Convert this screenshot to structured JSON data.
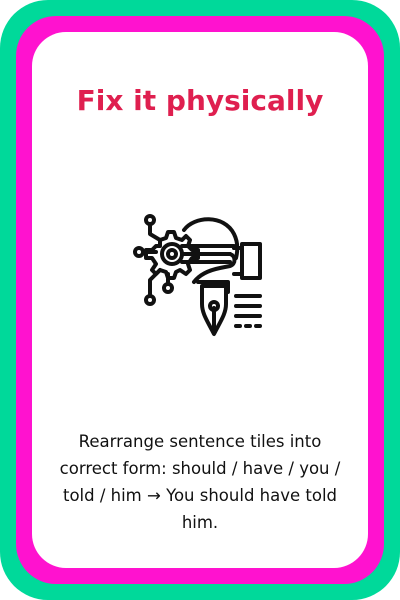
{
  "card": {
    "title": "Fix it physically",
    "illustration_icon": "hand-gear-pen-icon",
    "description": "Rearrange sentence tiles into correct form: should / have / you / told / him → You should have told him."
  },
  "colors": {
    "outer_border": "#00d99a",
    "inner_border": "#ff12cf",
    "title": "#df1f4f",
    "background": "#ffffff"
  }
}
